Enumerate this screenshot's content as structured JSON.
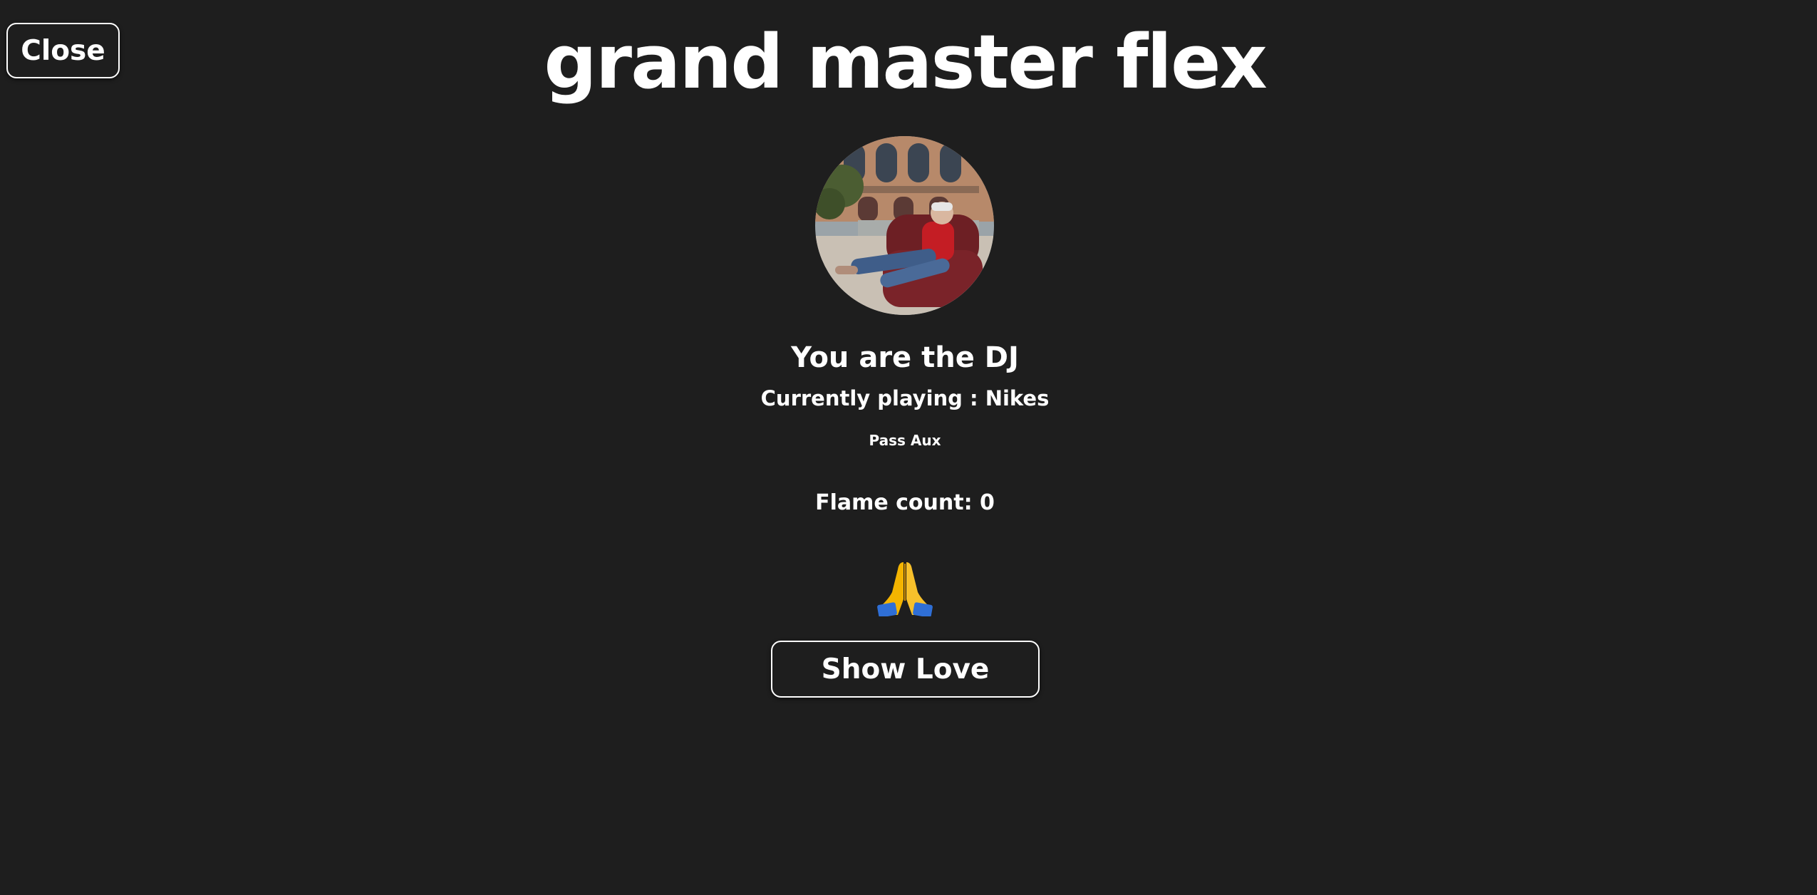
{
  "header": {
    "close_label": "Close",
    "title": "grand master flex"
  },
  "dj_panel": {
    "avatar_icon": "dj-profile-photo",
    "heading": "You are the DJ",
    "now_playing": "Currently playing : Nikes",
    "pass_aux_label": "Pass Aux",
    "flame_count": "Flame count: 0",
    "reaction_icon": "folded-hands-emoji",
    "show_love_label": "Show Love"
  },
  "colors": {
    "background": "#1e1e1e",
    "text": "#ffffff",
    "button_border": "#ffffff"
  }
}
